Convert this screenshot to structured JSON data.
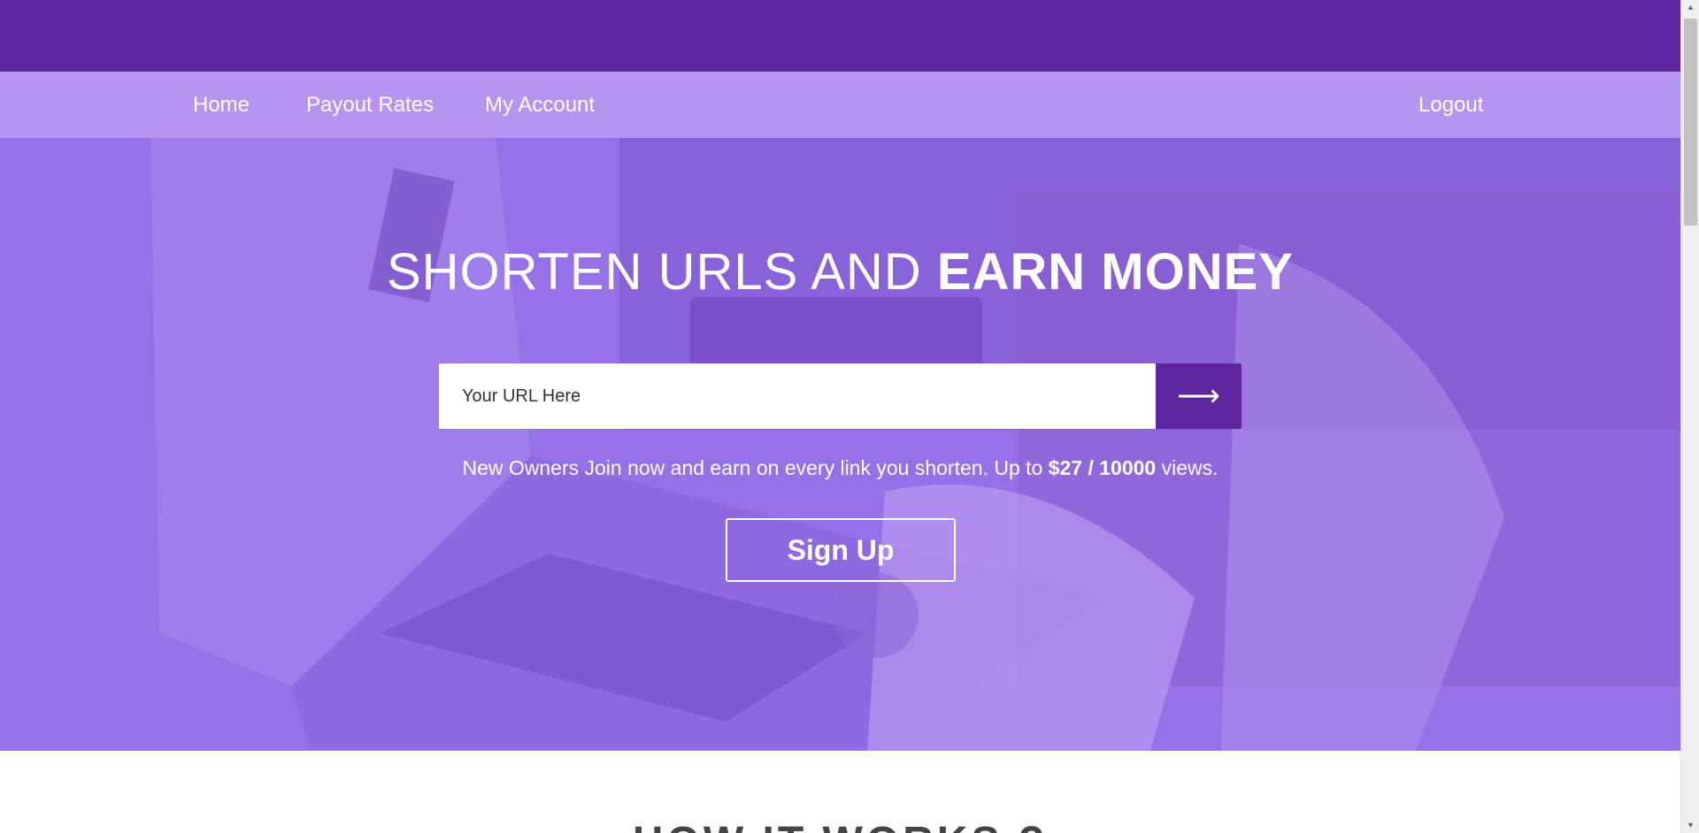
{
  "nav": {
    "home": "Home",
    "payout_rates": "Payout Rates",
    "my_account": "My Account",
    "logout": "Logout"
  },
  "hero": {
    "title_thin": "SHORTEN URLS AND",
    "title_bold": "EARN MONEY",
    "url_placeholder": "Your URL Here",
    "submit_icon": "arrow-right-icon",
    "submit_glyph": "⟶",
    "promo_prefix": "New Owners Join now and earn on every link you shorten. Up to",
    "promo_rate": "$27 / 10000",
    "promo_suffix": "views.",
    "signup_label": "Sign Up"
  },
  "section": {
    "heading": "HOW IT WORKS ?"
  },
  "colors": {
    "brand_dark": "#5e269e",
    "nav_bg": "#b694f0",
    "hero_overlay": "#9a72ea"
  }
}
